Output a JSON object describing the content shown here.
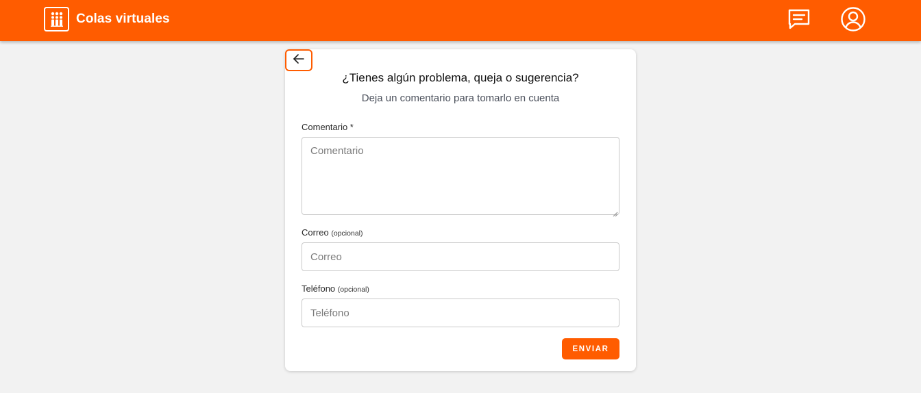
{
  "header": {
    "title": "Colas virtuales",
    "logo_icon": "queue-people-icon",
    "feedback_icon": "message-square-icon",
    "account_icon": "user-circle-icon",
    "background_color": "#ff5c00"
  },
  "card": {
    "back_icon": "arrow-left-icon",
    "title": "¿Tienes algún problema, queja o sugerencia?",
    "subtitle": "Deja un comentario para tomarlo en cuenta"
  },
  "form": {
    "comment": {
      "label": "Comentario *",
      "placeholder": "Comentario",
      "value": ""
    },
    "email": {
      "label": "Correo",
      "optional_note": "(opcional)",
      "placeholder": "Correo",
      "value": ""
    },
    "phone": {
      "label": "Teléfono",
      "optional_note": "(opcional)",
      "placeholder": "Teléfono",
      "value": ""
    },
    "submit_label": "ENVIAR"
  },
  "colors": {
    "accent": "#ff5c00",
    "page_background": "#f2f2f2",
    "card_background": "#ffffff"
  }
}
